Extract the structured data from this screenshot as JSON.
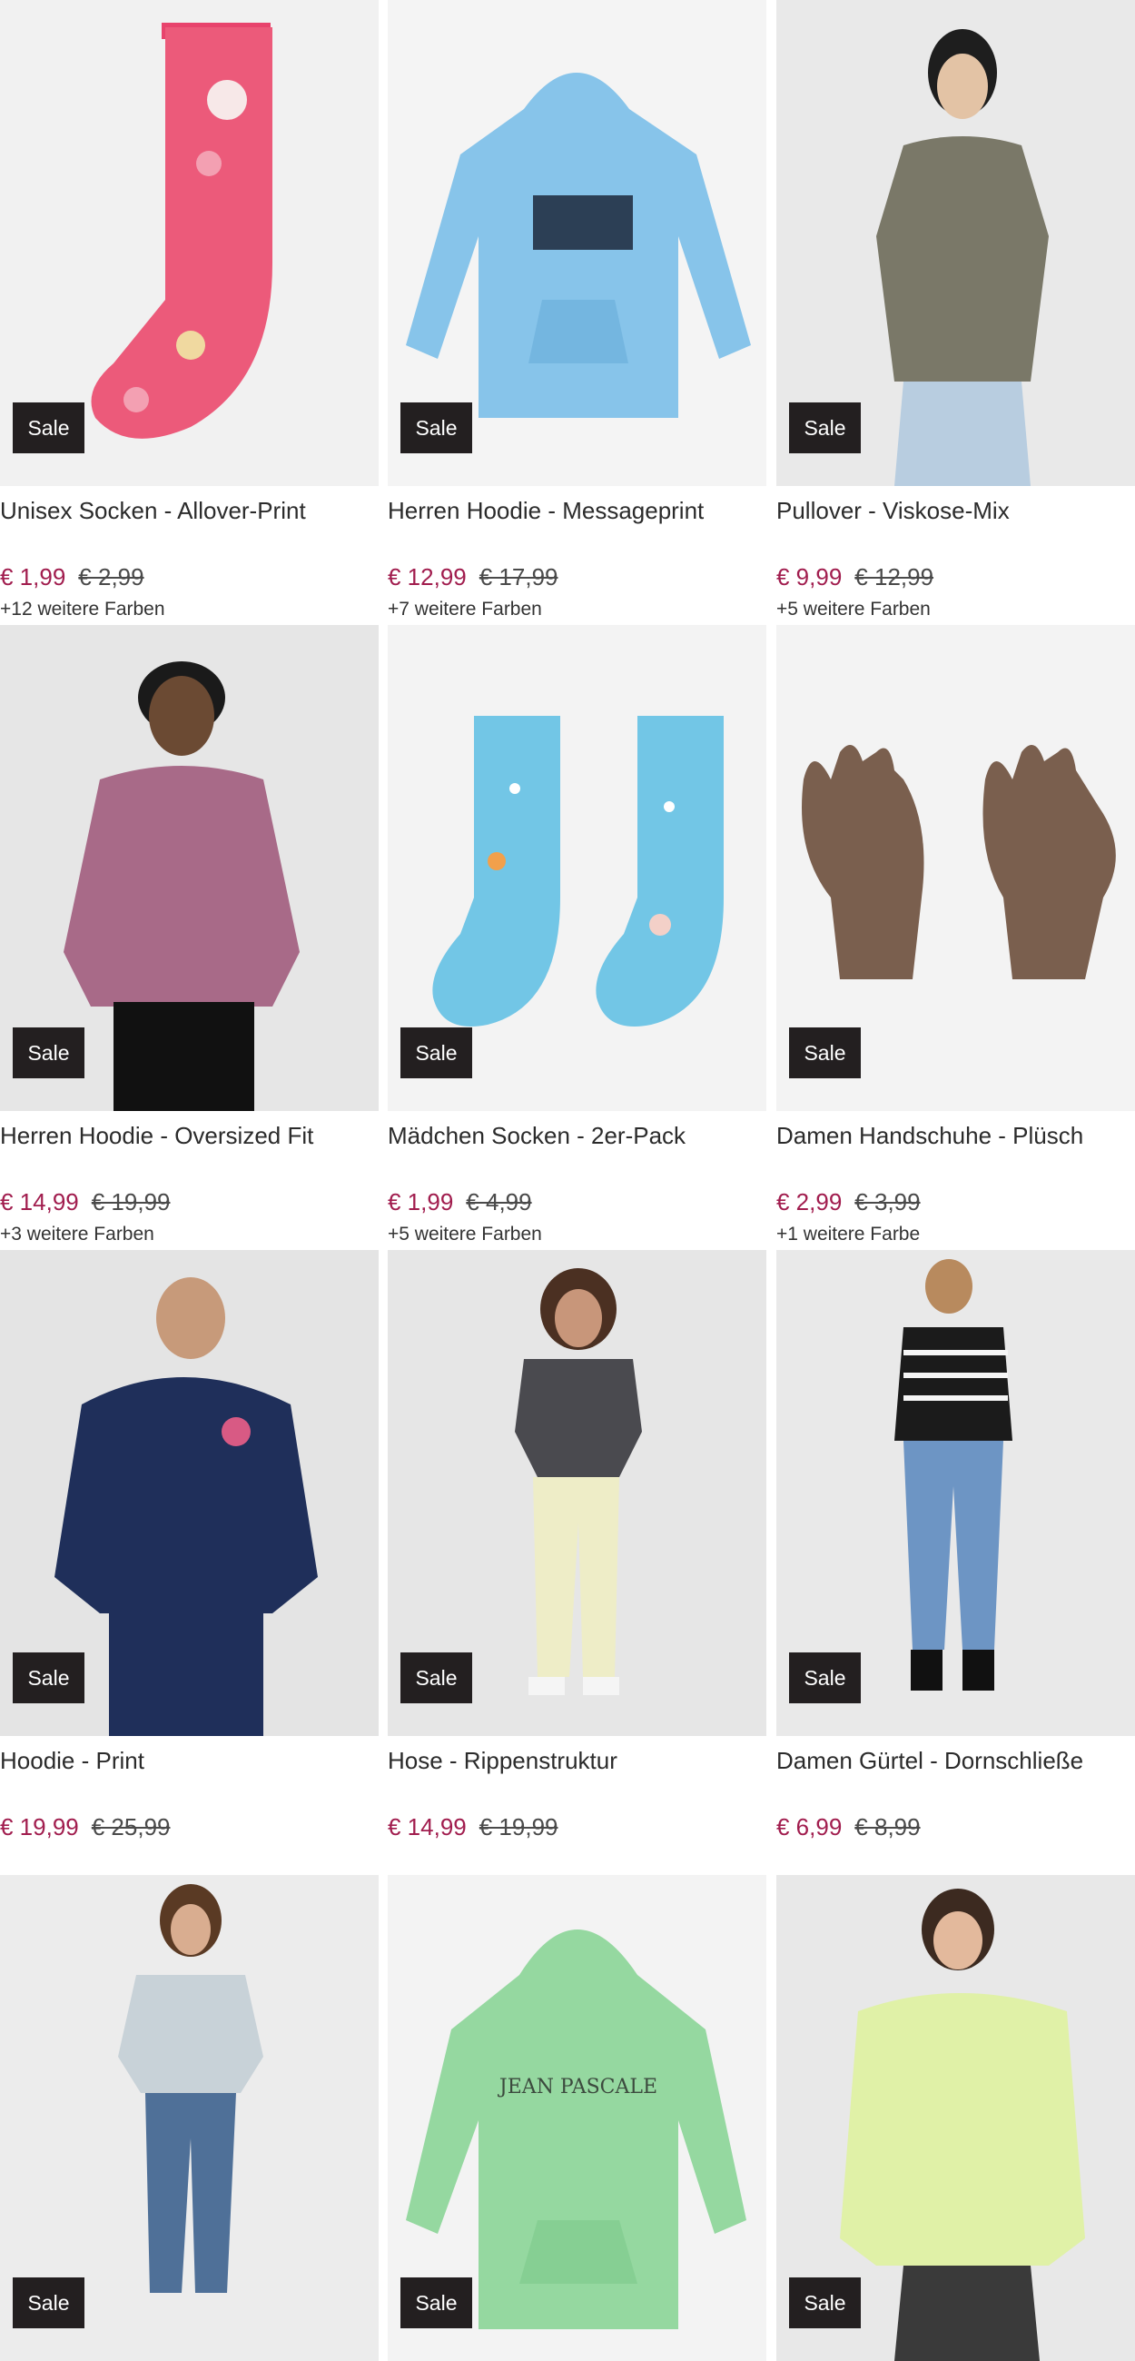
{
  "badge_label": "Sale",
  "colors": {
    "price": "#a11d4e",
    "badge_bg": "#231f20"
  },
  "products": [
    {
      "title": "Unisex Socken - Allover-Print",
      "price": "€ 1,99",
      "old_price": "€ 2,99",
      "more_colors": "+12 weitere Farben",
      "icon": "pink-sock-image"
    },
    {
      "title": "Herren Hoodie - Messageprint",
      "price": "€ 12,99",
      "old_price": "€ 17,99",
      "more_colors": "+7 weitere Farben",
      "icon": "light-blue-hoodie-image"
    },
    {
      "title": "Pullover - Viskose-Mix",
      "price": "€ 9,99",
      "old_price": "€ 12,99",
      "more_colors": "+5 weitere Farben",
      "icon": "woman-grey-pullover-image"
    },
    {
      "title": "Herren Hoodie - Oversized Fit",
      "price": "€ 14,99",
      "old_price": "€ 19,99",
      "more_colors": "+3 weitere Farben",
      "icon": "man-purple-hoodie-image"
    },
    {
      "title": "Mädchen Socken - 2er-Pack",
      "price": "€ 1,99",
      "old_price": "€ 4,99",
      "more_colors": "+5 weitere Farben",
      "icon": "blue-socks-pair-image"
    },
    {
      "title": "Damen Handschuhe - Plüsch",
      "price": "€ 2,99",
      "old_price": "€ 3,99",
      "more_colors": "+1 weitere Farbe",
      "icon": "brown-gloves-image"
    },
    {
      "title": "Hoodie - Print",
      "price": "€ 19,99",
      "old_price": "€ 25,99",
      "more_colors": "",
      "icon": "man-navy-hoodie-image"
    },
    {
      "title": "Hose - Rippenstruktur",
      "price": "€ 14,99",
      "old_price": "€ 19,99",
      "more_colors": "",
      "icon": "woman-cream-pants-image"
    },
    {
      "title": "Damen Gürtel - Dornschließe",
      "price": "€ 6,99",
      "old_price": "€ 8,99",
      "more_colors": "",
      "icon": "woman-striped-sweater-image"
    },
    {
      "title": "",
      "price": "",
      "old_price": "",
      "more_colors": "",
      "icon": "woman-leopard-top-image"
    },
    {
      "title": "",
      "price": "",
      "old_price": "",
      "more_colors": "",
      "icon": "mint-hoodie-image"
    },
    {
      "title": "",
      "price": "",
      "old_price": "",
      "more_colors": "",
      "icon": "woman-lime-sweatshirt-image"
    }
  ]
}
